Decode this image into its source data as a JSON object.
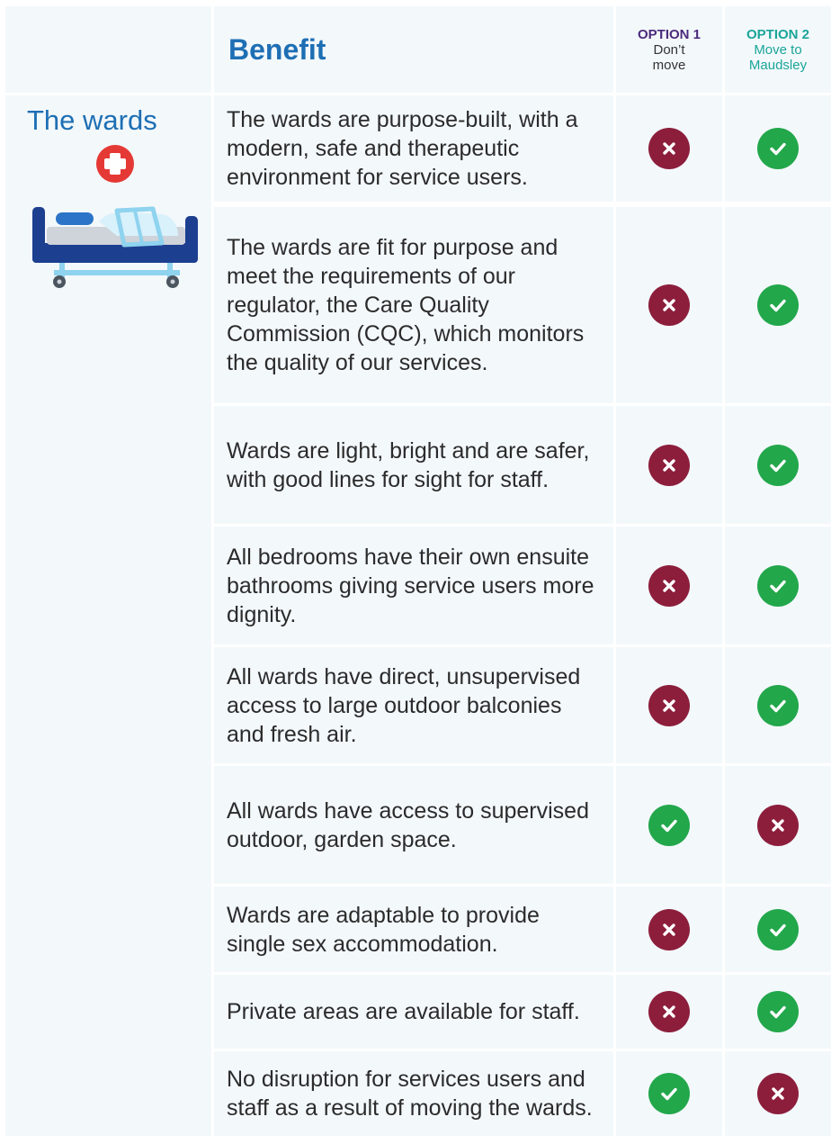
{
  "header": {
    "benefit_label": "Benefit",
    "option1": {
      "title": "OPTION 1",
      "line1": "Don’t",
      "line2": "move"
    },
    "option2": {
      "title": "OPTION 2",
      "line1": "Move to",
      "line2": "Maudsley"
    }
  },
  "section": {
    "title": "The wards",
    "illustration": "hospital-bed-icon"
  },
  "colors": {
    "yes": "#22a74b",
    "no": "#8c1e3c",
    "heading": "#1e6fb4",
    "opt1": "#4b2a7b",
    "opt2": "#1aa598",
    "cell_bg": "#f3f8fb"
  },
  "rows": [
    {
      "text": "The wards are purpose-built, with a modern, safe and therapeutic environment for service users.",
      "option1": "no",
      "option2": "yes"
    },
    {
      "text": "The wards are fit for purpose and meet the requirements of our regulator, the Care Quality Commission (CQC), which monitors the quality of our services.",
      "option1": "no",
      "option2": "yes"
    },
    {
      "text": "Wards are light, bright and are safer, with good lines for sight for staff.",
      "option1": "no",
      "option2": "yes"
    },
    {
      "text": "All bedrooms have their own ensuite bathrooms giving service users more dignity.",
      "option1": "no",
      "option2": "yes"
    },
    {
      "text": "All wards have direct, unsupervised access to large outdoor balconies and fresh air.",
      "option1": "no",
      "option2": "yes"
    },
    {
      "text": "All wards have access to supervised outdoor, garden space.",
      "option1": "yes",
      "option2": "no"
    },
    {
      "text": "Wards are adaptable to provide single sex accommodation.",
      "option1": "no",
      "option2": "yes"
    },
    {
      "text": "Private areas are available for staff.",
      "option1": "no",
      "option2": "yes"
    },
    {
      "text": "No disruption for services users and staff as a result of moving the wards.",
      "option1": "yes",
      "option2": "no"
    }
  ]
}
